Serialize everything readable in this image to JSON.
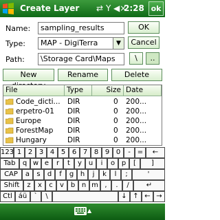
{
  "title_bar": {
    "title": "Create Layer",
    "time": "2:28",
    "ok_label": "ok",
    "signal_icon": "signal-arrows-icon",
    "antenna_icon": "antenna-icon",
    "volume_icon": "speaker-icon"
  },
  "form": {
    "name_label": "Name:",
    "name_value": "sampling_results",
    "type_label": "Type:",
    "type_value": "MAP - DigiTerra",
    "path_label": "Path:",
    "path_value": "\\Storage Card\\Maps",
    "ok_button": "OK",
    "cancel_button": "Cancel",
    "root_button": "\\",
    "up_button": ".."
  },
  "actions": {
    "new_directory": "New directory",
    "rename": "Rename",
    "delete": "Delete"
  },
  "list": {
    "columns": [
      "File",
      "Type",
      "Size",
      "Date"
    ],
    "rows": [
      {
        "name": "Code_dicti...",
        "type": "DIR",
        "size": "0",
        "date": "200..."
      },
      {
        "name": "erpetro-01",
        "type": "DIR",
        "size": "0",
        "date": "200..."
      },
      {
        "name": "Europe",
        "type": "DIR",
        "size": "0",
        "date": "200..."
      },
      {
        "name": "ForestMap",
        "type": "DIR",
        "size": "0",
        "date": "200..."
      },
      {
        "name": "Hungary",
        "type": "DIR",
        "size": "0",
        "date": "200..."
      }
    ]
  },
  "keyboard": {
    "row1": [
      "123",
      "1",
      "2",
      "3",
      "4",
      "5",
      "6",
      "7",
      "8",
      "9",
      "0",
      "-",
      "=",
      "←"
    ],
    "row2": [
      "Tab",
      "q",
      "w",
      "e",
      "r",
      "t",
      "y",
      "u",
      "i",
      "o",
      "p",
      "[",
      "]"
    ],
    "row3": [
      "CAP",
      "a",
      "s",
      "d",
      "f",
      "g",
      "h",
      "j",
      "k",
      "l",
      ";",
      "'"
    ],
    "row4": [
      "Shift",
      "z",
      "x",
      "c",
      "v",
      "b",
      "n",
      "m",
      ",",
      ".",
      "/",
      "↵"
    ],
    "row5": [
      "Ctl",
      "áü",
      "`",
      "\\",
      "↓",
      "↑",
      "←",
      "→"
    ]
  },
  "colors": {
    "title_bar": "#1e7a26",
    "accent": "#3c9a3c",
    "folder": "#e8c24a"
  }
}
